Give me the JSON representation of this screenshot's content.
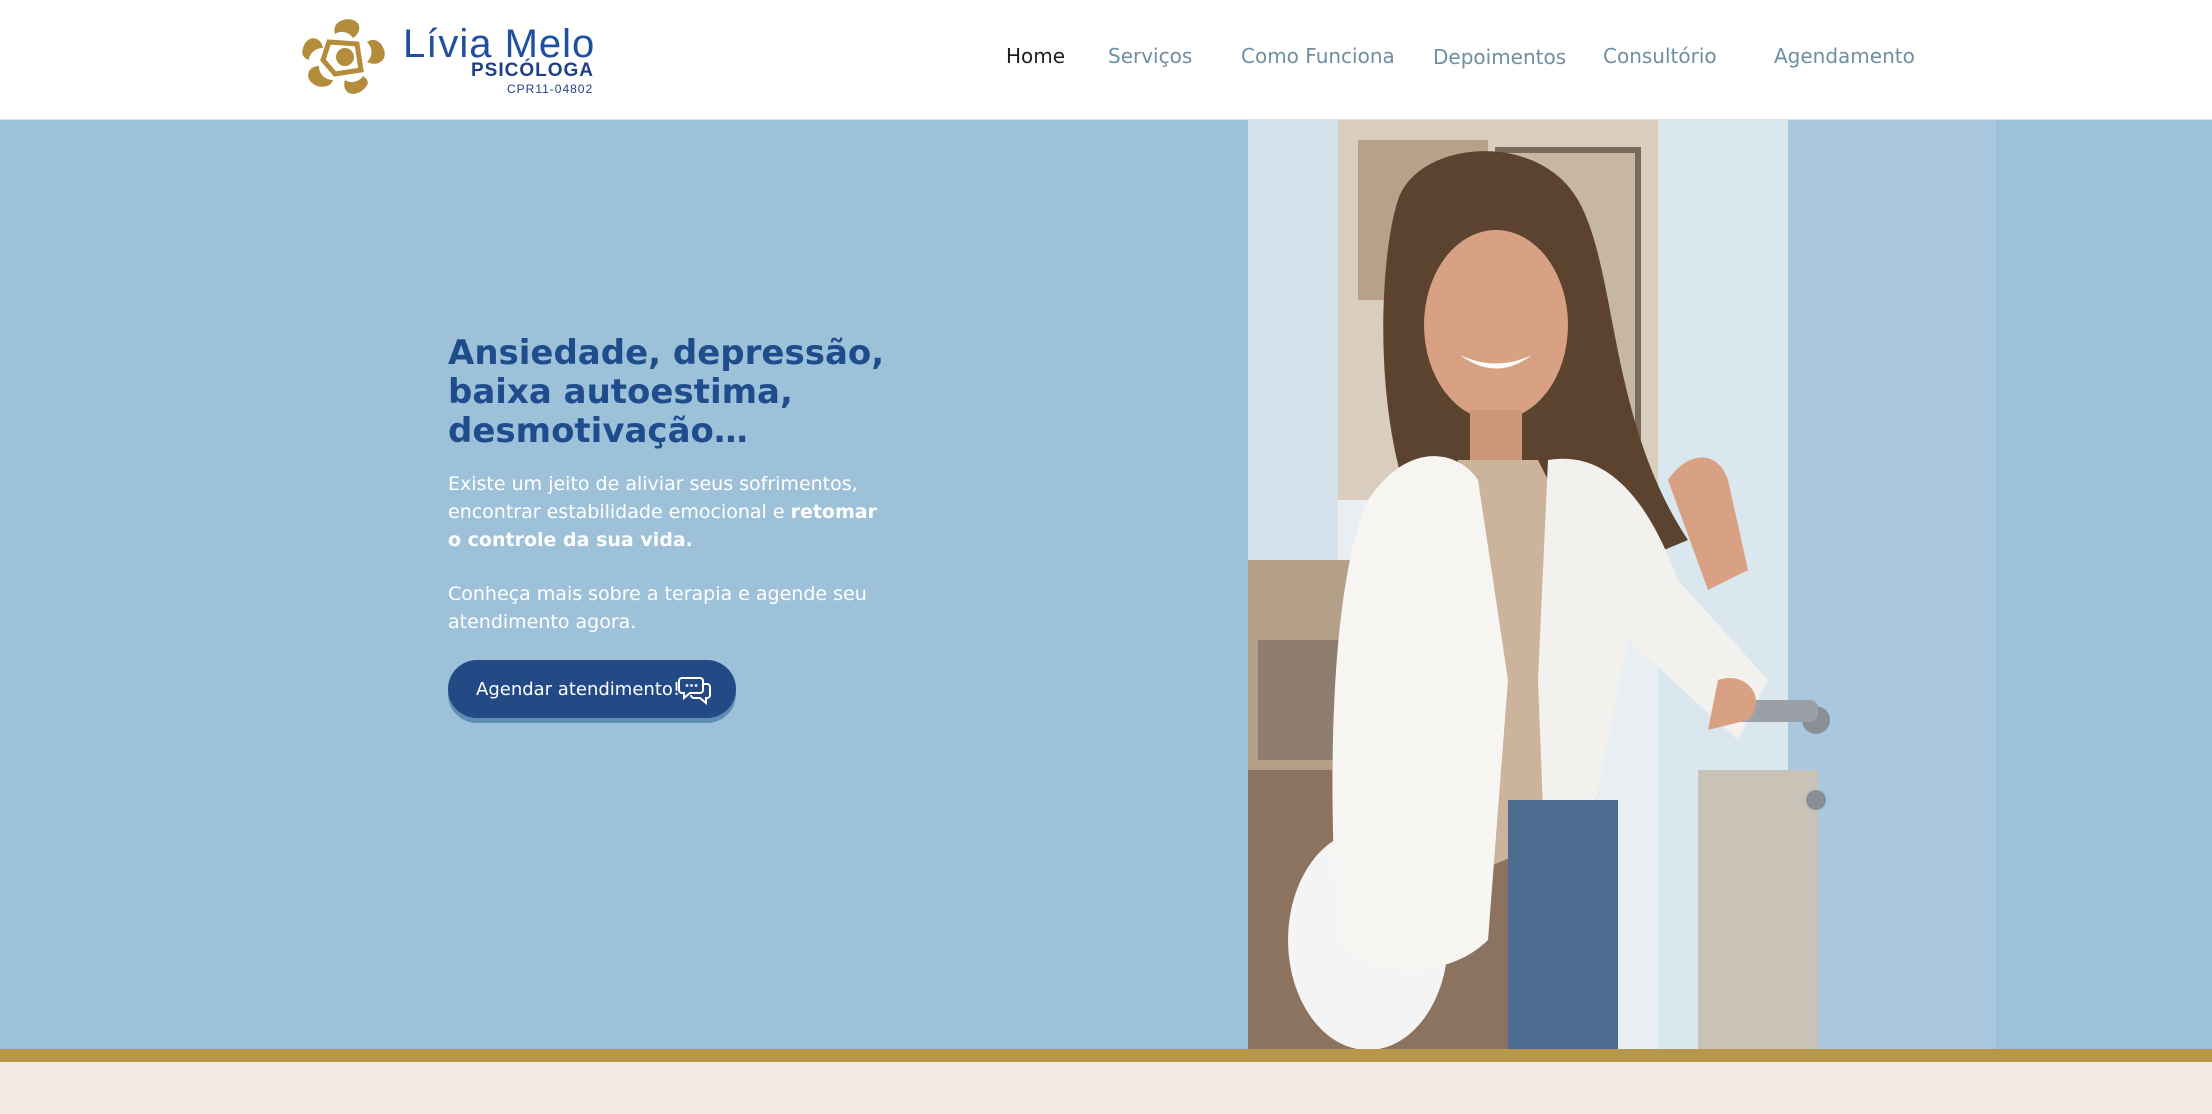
{
  "brand": {
    "name": "Lívia Melo",
    "role": "PSICÓLOGA",
    "registration": "CPR11-04802",
    "logo_icon": "star-swirl-icon",
    "gold": "#b8974a",
    "blue": "#1f4fa0"
  },
  "nav": {
    "items": [
      {
        "label": "Home",
        "active": true
      },
      {
        "label": "Serviços"
      },
      {
        "label": "Como Funciona"
      },
      {
        "label": "Depoimentos"
      },
      {
        "label": "Consultório"
      },
      {
        "label": "Agendamento"
      }
    ]
  },
  "hero": {
    "title": "Ansiedade, depressão, baixa autoestima, desmotivação…",
    "text_plain": "Existe um jeito de aliviar seus sofrimentos, encontrar estabilidade emocional e ",
    "text_bold": "retomar o controle da sua vida.",
    "text2": "Conheça mais sobre a terapia e agende seu atendimento agora.",
    "cta_label": "Agendar atendimento!",
    "cta_icon": "chat-bubbles-icon",
    "background": "#9ec1da",
    "photo": "portrait-photo"
  }
}
